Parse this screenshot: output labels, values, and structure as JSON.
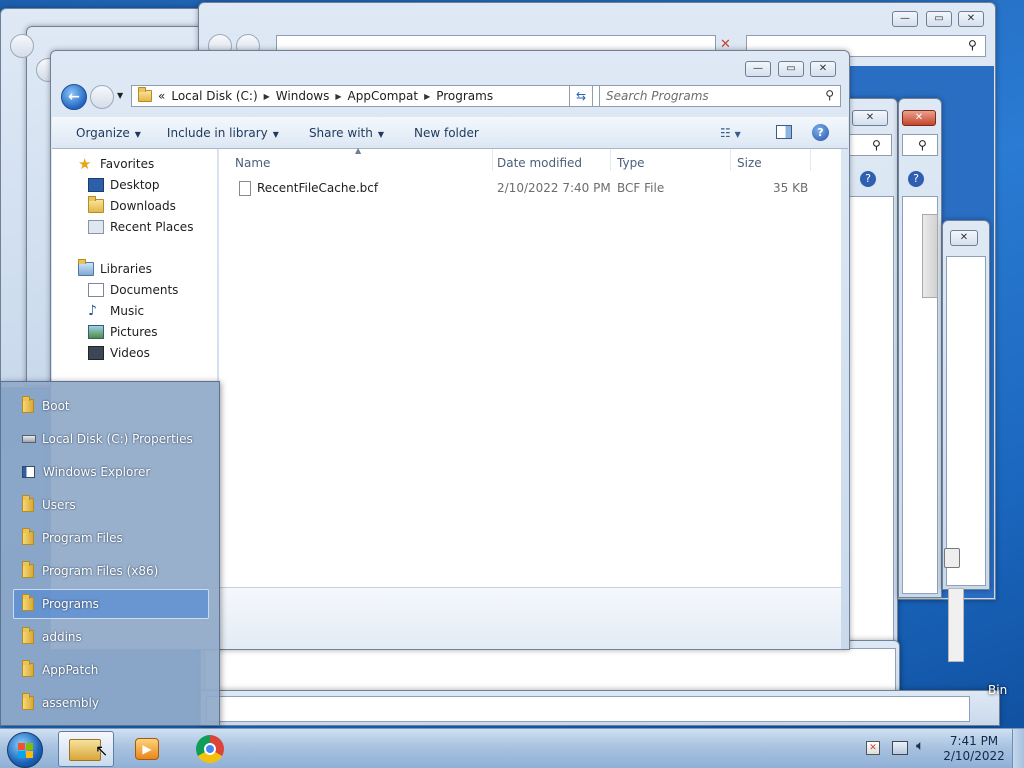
{
  "explorer": {
    "address_prefix": "«",
    "breadcrumb": [
      "Local Disk (C:)",
      "Windows",
      "AppCompat",
      "Programs"
    ],
    "search_placeholder": "Search Programs",
    "toolbar": {
      "organize": "Organize",
      "include_in_library": "Include in library",
      "share_with": "Share with",
      "new_folder": "New folder"
    },
    "nav": {
      "favorites": "Favorites",
      "desktop": "Desktop",
      "downloads": "Downloads",
      "recent_places": "Recent Places",
      "libraries": "Libraries",
      "documents": "Documents",
      "music": "Music",
      "pictures": "Pictures",
      "videos": "Videos"
    },
    "columns": {
      "name": "Name",
      "date_modified": "Date modified",
      "type": "Type",
      "size": "Size"
    },
    "files": [
      {
        "name": "RecentFileCache.bcf",
        "date": "2/10/2022 7:40 PM",
        "type": "BCF File",
        "size": "35 KB"
      }
    ]
  },
  "jump_list": {
    "items": [
      "Boot",
      "Local Disk (C:) Properties",
      "Windows Explorer",
      "Users",
      "Program Files",
      "Program Files (x86)",
      "Programs",
      "addins",
      "AppPatch",
      "assembly"
    ],
    "selected": "Programs"
  },
  "taskbar": {
    "time": "7:41 PM",
    "date": "2/10/2022"
  },
  "desktop": {
    "recycle_bin_partial": "Bin"
  },
  "colors": {
    "desktop": "#2a7bd3",
    "jump_list_bg": "#91aac8",
    "toolbar_text": "#1e395b",
    "close_red": "#c7442b"
  }
}
